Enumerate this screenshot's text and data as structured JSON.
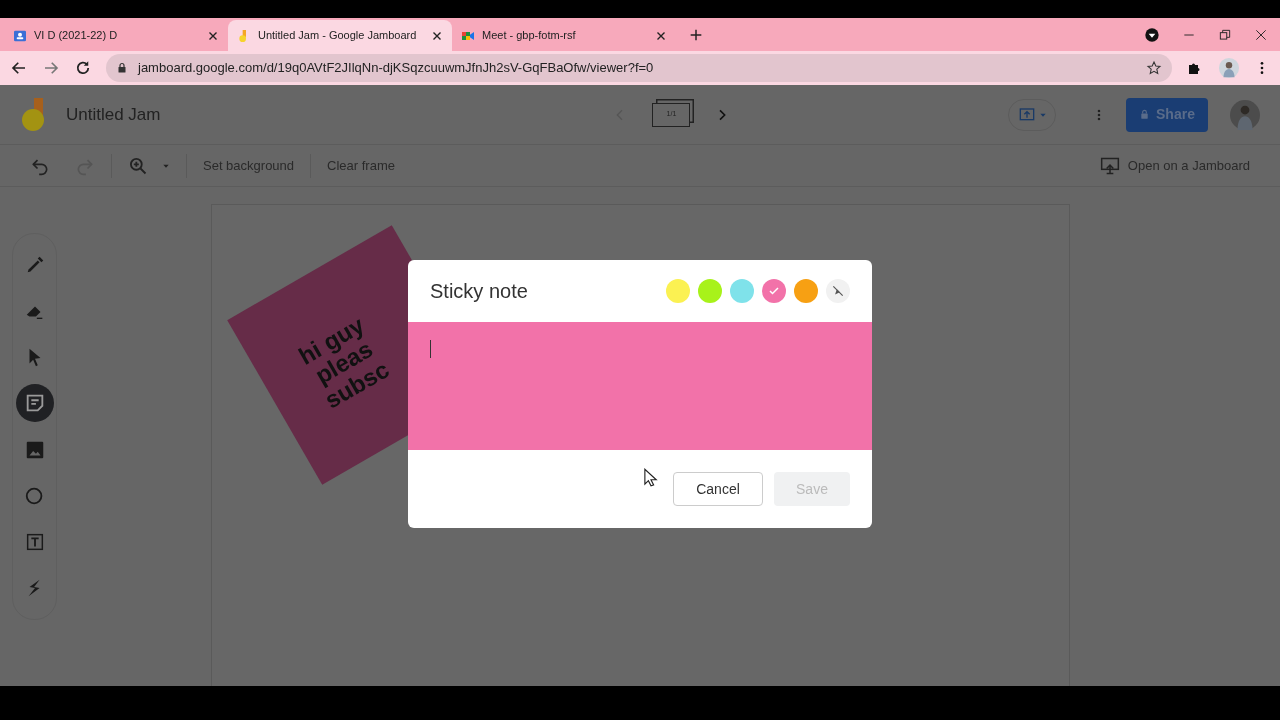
{
  "browser": {
    "tabs": [
      {
        "title": "VI D (2021-22) D",
        "selected": false
      },
      {
        "title": "Untitled Jam - Google Jamboard",
        "selected": true
      },
      {
        "title": "Meet - gbp-fotm-rsf",
        "selected": false
      }
    ],
    "url": "jamboard.google.com/d/19q0AVtF2JIlqNn-djKSqzcuuwmJfnJh2sV-GqFBaOfw/viewer?f=0"
  },
  "app": {
    "title": "Untitled Jam",
    "frame_counter": "1/1",
    "share_label": "Share",
    "redo_disabled": true,
    "toolbar": [
      "Set background",
      "Clear frame"
    ],
    "open_on_jamboard": "Open on a Jamboard",
    "tools": [
      {
        "kind": "pen",
        "selected": false
      },
      {
        "kind": "eraser",
        "selected": false
      },
      {
        "kind": "select",
        "selected": false
      },
      {
        "kind": "sticky",
        "selected": true
      },
      {
        "kind": "image",
        "selected": false
      },
      {
        "kind": "circle",
        "selected": false
      },
      {
        "kind": "textbox",
        "selected": false
      },
      {
        "kind": "laser",
        "selected": false
      }
    ]
  },
  "canvas": {
    "notes": [
      {
        "lines": [
          "hi guy",
          "pleas",
          "subsc"
        ],
        "color": "#662c48"
      }
    ]
  },
  "dialog": {
    "title": "Sticky note",
    "colors": [
      {
        "kind": "swatch",
        "color": "#fbf152",
        "selected": false
      },
      {
        "kind": "swatch",
        "color": "#a8f21a",
        "selected": false
      },
      {
        "kind": "swatch",
        "color": "#7fe2ea",
        "selected": false
      },
      {
        "kind": "swatch",
        "color": "#f272a9",
        "selected": true
      },
      {
        "kind": "swatch",
        "color": "#f7a013",
        "selected": false
      },
      {
        "kind": "none",
        "selected": false
      }
    ],
    "cancel": "Cancel",
    "save": "Save",
    "save_disabled": true
  }
}
